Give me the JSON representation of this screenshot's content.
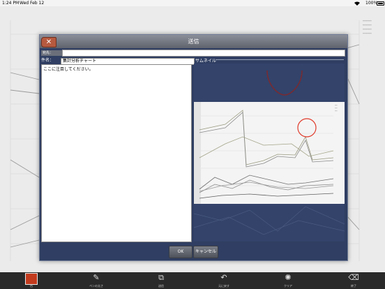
{
  "status_bar": {
    "time": "1:24 PM",
    "date": "Wed Feb 12",
    "battery": "100%"
  },
  "dialog": {
    "title": "送信",
    "destination_label": "宛先：",
    "destination_value": "",
    "subject_label": "件名：",
    "subject_value": "集計分析チャート",
    "body_text": "ここに注目してください。",
    "thumbnail_label": "サムネイル",
    "ok_label": "OK",
    "cancel_label": "キャンセル",
    "close_icon": "close-icon"
  },
  "toolbar": {
    "items": [
      {
        "label": "色",
        "icon": "color-swatch"
      },
      {
        "label": "ペンの太さ",
        "icon": "pen-icon"
      },
      {
        "label": "送信",
        "icon": "send-icon"
      },
      {
        "label": "元に戻す",
        "icon": "undo-icon"
      },
      {
        "label": "クリア",
        "icon": "clear-icon"
      },
      {
        "label": "終了",
        "icon": "exit-icon"
      }
    ]
  },
  "colors": {
    "dialog_bg": "#2f3e62",
    "pen_color": "#c23b1e",
    "annotation_circle": "#e03a2a"
  }
}
